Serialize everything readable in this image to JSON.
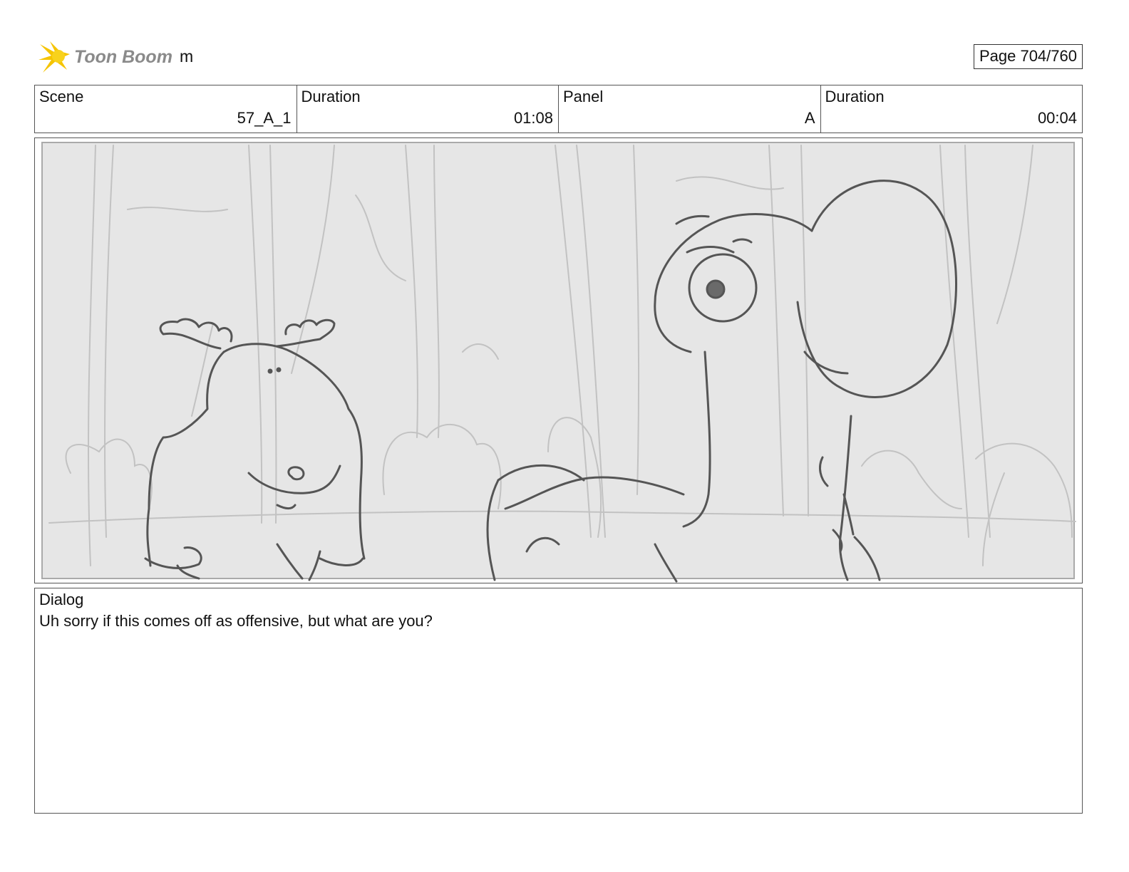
{
  "header": {
    "logo_text": "Toon Boom",
    "project_name": "m",
    "page_indicator": "Page 704/760"
  },
  "info_table": {
    "scene_label": "Scene",
    "scene_value": "57_A_1",
    "scene_duration_label": "Duration",
    "scene_duration_value": "01:08",
    "panel_label": "Panel",
    "panel_value": "A",
    "panel_duration_label": "Duration",
    "panel_duration_value": "00:04"
  },
  "dialog": {
    "label": "Dialog",
    "text": "Uh sorry if this comes off as offensive, but what are you?"
  },
  "colors": {
    "logo_burst": "#f5c400",
    "panel_background": "#e6e6e6",
    "sketch_line": "#555555",
    "background_sketch": "#c2c2c2"
  }
}
